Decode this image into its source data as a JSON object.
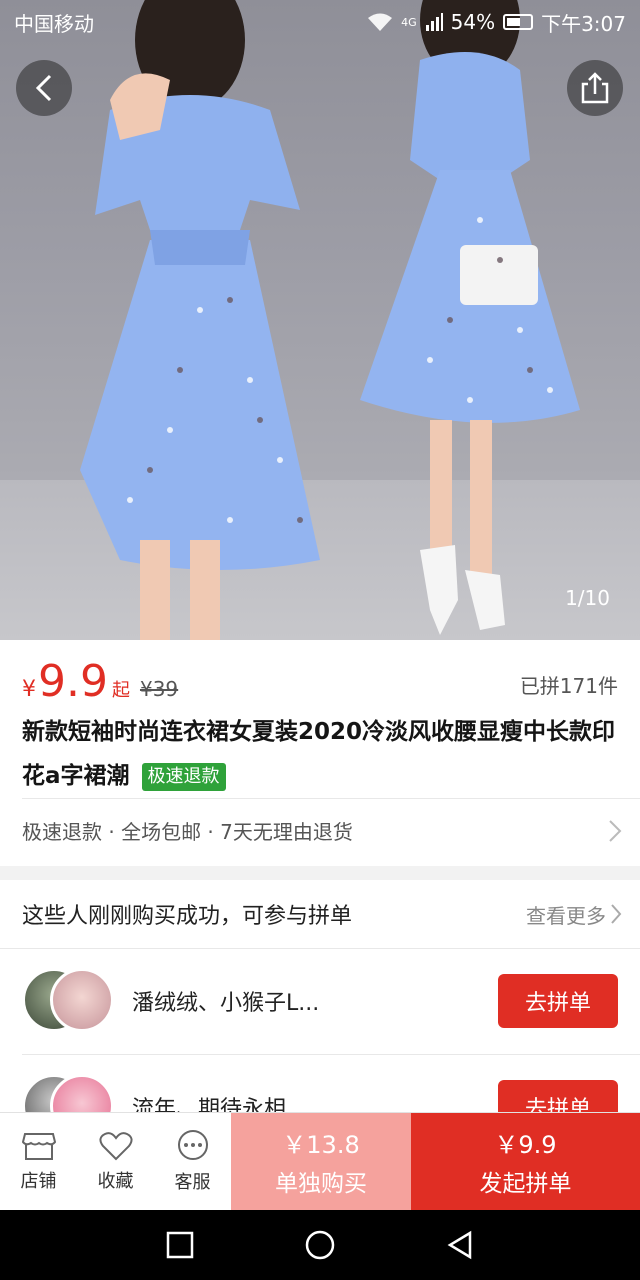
{
  "status_bar": {
    "carrier": "中国移动",
    "network": "4G",
    "battery": "54%",
    "time": "下午3:07"
  },
  "gallery": {
    "counter": "1/10"
  },
  "product": {
    "price_currency": "¥",
    "price": "9.9",
    "price_suffix": "起",
    "original_price": "¥39",
    "sold": "已拼171件",
    "title": "新款短袖时尚连衣裙女夏装2020冷淡风收腰显瘦中长款印花a字裙潮",
    "badge": "极速退款",
    "services": "极速退款 · 全场包邮 · 7天无理由退货"
  },
  "group_buy": {
    "heading": "这些人刚刚购买成功，可参与拼单",
    "see_more": "查看更多",
    "rows": [
      {
        "name": "潘绒绒、小猴子L...",
        "action": "去拼单"
      },
      {
        "name": "流年、期待永相",
        "action": "去拼单"
      }
    ]
  },
  "bottom_bar": {
    "store": "店铺",
    "favorite": "收藏",
    "service": "客服",
    "solo_price": "￥13.8",
    "solo_label": "单独购买",
    "group_price": "￥9.9",
    "group_label": "发起拼单"
  },
  "colors": {
    "accent": "#e02e24",
    "solo": "#f5a29d",
    "badge": "#2fa23a"
  }
}
